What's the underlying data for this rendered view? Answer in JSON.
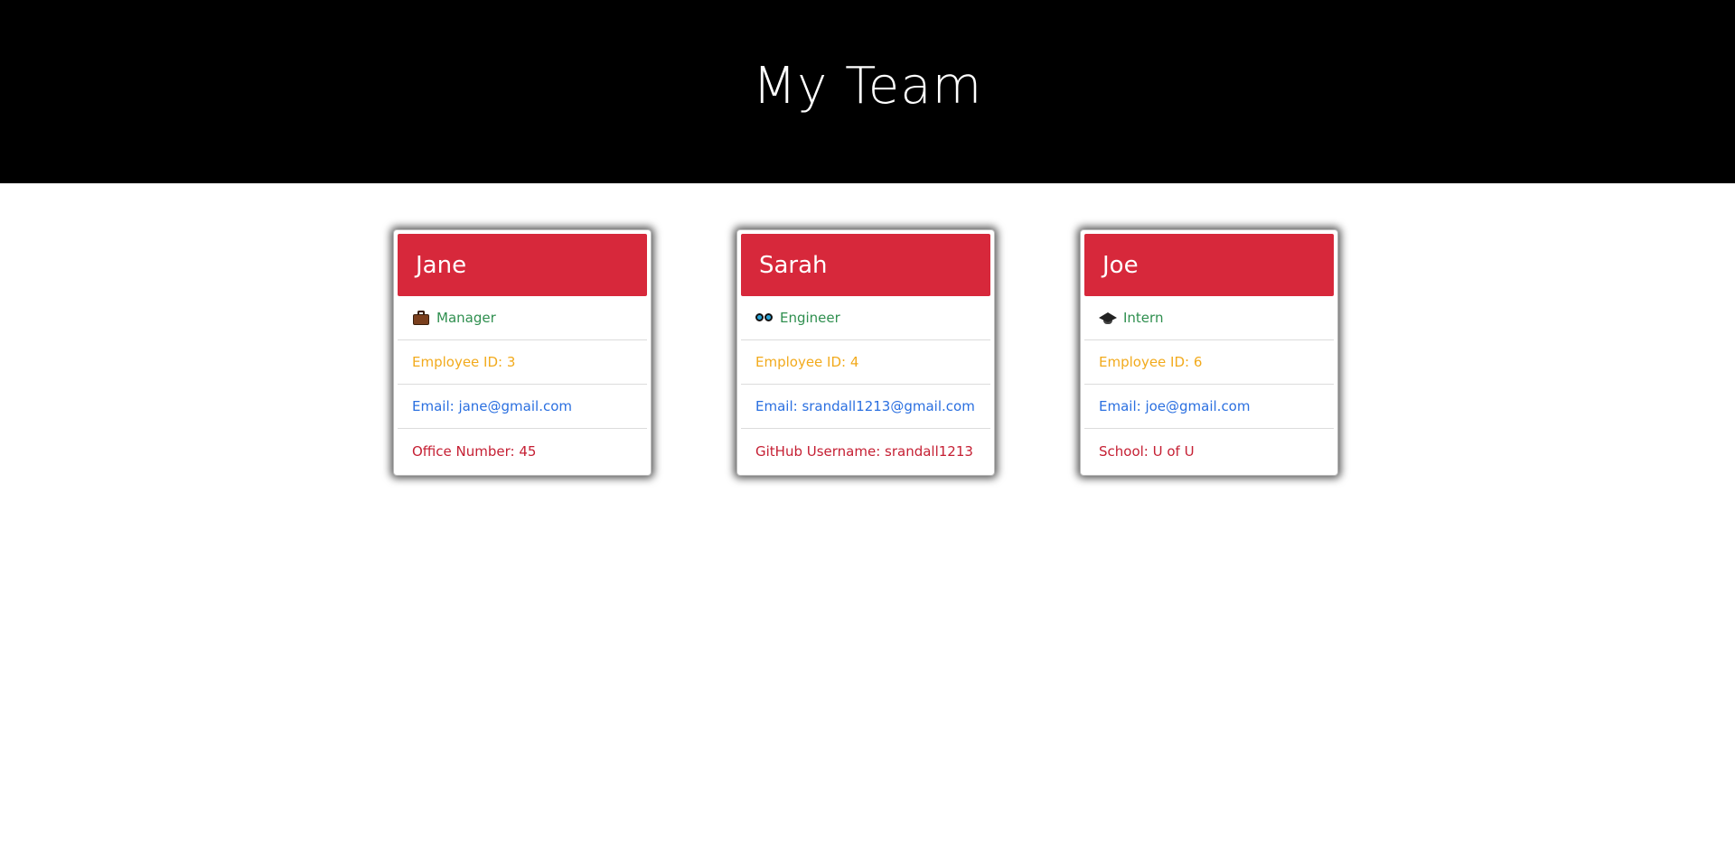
{
  "header": {
    "title": "My Team"
  },
  "colors": {
    "header_bg": "#000000",
    "card_head_bg": "#d7283b",
    "role": "#2f8f4f",
    "employee_id": "#f2aa1c",
    "email": "#2a6fe0",
    "extra": "#c51f33"
  },
  "team": [
    {
      "name": "Jane",
      "role": "Manager",
      "role_icon": "briefcase-icon",
      "employee_id": "Employee ID: 3",
      "email": "Email: jane@gmail.com",
      "extra": "Office Number: 45"
    },
    {
      "name": "Sarah",
      "role": "Engineer",
      "role_icon": "goggles-icon",
      "employee_id": "Employee ID: 4",
      "email": "Email: srandall1213@gmail.com",
      "extra": "GitHub Username: srandall1213"
    },
    {
      "name": "Joe",
      "role": "Intern",
      "role_icon": "graduation-cap-icon",
      "employee_id": "Employee ID: 6",
      "email": "Email: joe@gmail.com",
      "extra": "School: U of U"
    }
  ]
}
